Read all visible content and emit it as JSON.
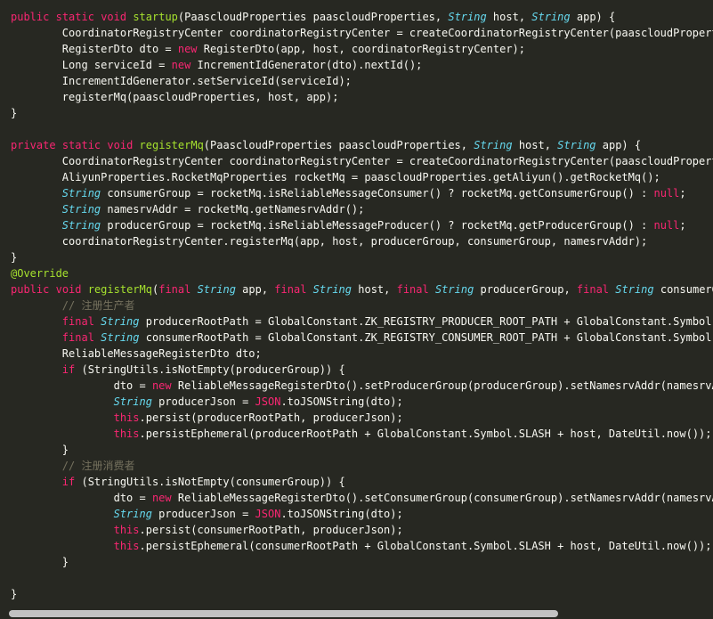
{
  "editor": {
    "scrollbar": {
      "thumb_fraction": 0.79
    },
    "colors": {
      "background": "#272822",
      "keyword": "#f92672",
      "type": "#66d9ef",
      "function": "#a6e22e",
      "comment": "#75715e",
      "plain": "#f8f8f2"
    },
    "lines": [
      [
        [
          "kw",
          "public"
        ],
        [
          "pl",
          " "
        ],
        [
          "kw",
          "static"
        ],
        [
          "pl",
          " "
        ],
        [
          "kw",
          "void"
        ],
        [
          "pl",
          " "
        ],
        [
          "fn",
          "startup"
        ],
        [
          "pl",
          "(PaascloudProperties paascloudProperties, "
        ],
        [
          "ty",
          "String"
        ],
        [
          "pl",
          " host, "
        ],
        [
          "ty",
          "String"
        ],
        [
          "pl",
          " app) {"
        ]
      ],
      [
        [
          "pl",
          "        CoordinatorRegistryCenter coordinatorRegistryCenter = createCoordinatorRegistryCenter(paascloudPropert"
        ]
      ],
      [
        [
          "pl",
          "        RegisterDto dto = "
        ],
        [
          "kw",
          "new"
        ],
        [
          "pl",
          " RegisterDto(app, host, coordinatorRegistryCenter);"
        ]
      ],
      [
        [
          "pl",
          "        Long serviceId = "
        ],
        [
          "kw",
          "new"
        ],
        [
          "pl",
          " IncrementIdGenerator(dto).nextId();"
        ]
      ],
      [
        [
          "pl",
          "        IncrementIdGenerator.setServiceId(serviceId);"
        ]
      ],
      [
        [
          "pl",
          "        registerMq(paascloudProperties, host, app);"
        ]
      ],
      [
        [
          "pl",
          "}"
        ]
      ],
      [
        [
          "pl",
          ""
        ]
      ],
      [
        [
          "kw",
          "private"
        ],
        [
          "pl",
          " "
        ],
        [
          "kw",
          "static"
        ],
        [
          "pl",
          " "
        ],
        [
          "kw",
          "void"
        ],
        [
          "pl",
          " "
        ],
        [
          "fn",
          "registerMq"
        ],
        [
          "pl",
          "(PaascloudProperties paascloudProperties, "
        ],
        [
          "ty",
          "String"
        ],
        [
          "pl",
          " host, "
        ],
        [
          "ty",
          "String"
        ],
        [
          "pl",
          " app) {"
        ]
      ],
      [
        [
          "pl",
          "        CoordinatorRegistryCenter coordinatorRegistryCenter = createCoordinatorRegistryCenter(paascloudPropert"
        ]
      ],
      [
        [
          "pl",
          "        AliyunProperties.RocketMqProperties rocketMq = paascloudProperties.getAliyun().getRocketMq();"
        ]
      ],
      [
        [
          "pl",
          "        "
        ],
        [
          "ty",
          "String"
        ],
        [
          "pl",
          " consumerGroup = rocketMq.isReliableMessageConsumer() ? rocketMq.getConsumerGroup() : "
        ],
        [
          "kw",
          "null"
        ],
        [
          "pl",
          ";"
        ]
      ],
      [
        [
          "pl",
          "        "
        ],
        [
          "ty",
          "String"
        ],
        [
          "pl",
          " namesrvAddr = rocketMq.getNamesrvAddr();"
        ]
      ],
      [
        [
          "pl",
          "        "
        ],
        [
          "ty",
          "String"
        ],
        [
          "pl",
          " producerGroup = rocketMq.isReliableMessageProducer() ? rocketMq.getProducerGroup() : "
        ],
        [
          "kw",
          "null"
        ],
        [
          "pl",
          ";"
        ]
      ],
      [
        [
          "pl",
          "        coordinatorRegistryCenter.registerMq(app, host, producerGroup, consumerGroup, namesrvAddr);"
        ]
      ],
      [
        [
          "pl",
          "}"
        ]
      ],
      [
        [
          "an",
          "@Override"
        ]
      ],
      [
        [
          "kw",
          "public"
        ],
        [
          "pl",
          " "
        ],
        [
          "kw",
          "void"
        ],
        [
          "pl",
          " "
        ],
        [
          "fn",
          "registerMq"
        ],
        [
          "pl",
          "("
        ],
        [
          "kw",
          "final"
        ],
        [
          "pl",
          " "
        ],
        [
          "ty",
          "String"
        ],
        [
          "pl",
          " app, "
        ],
        [
          "kw",
          "final"
        ],
        [
          "pl",
          " "
        ],
        [
          "ty",
          "String"
        ],
        [
          "pl",
          " host, "
        ],
        [
          "kw",
          "final"
        ],
        [
          "pl",
          " "
        ],
        [
          "ty",
          "String"
        ],
        [
          "pl",
          " producerGroup, "
        ],
        [
          "kw",
          "final"
        ],
        [
          "pl",
          " "
        ],
        [
          "ty",
          "String"
        ],
        [
          "pl",
          " consumerG"
        ]
      ],
      [
        [
          "pl",
          "        "
        ],
        [
          "cm",
          "// 注册生产者"
        ]
      ],
      [
        [
          "pl",
          "        "
        ],
        [
          "kw",
          "final"
        ],
        [
          "pl",
          " "
        ],
        [
          "ty",
          "String"
        ],
        [
          "pl",
          " producerRootPath = GlobalConstant.ZK_REGISTRY_PRODUCER_ROOT_PATH + GlobalConstant.Symbol."
        ]
      ],
      [
        [
          "pl",
          "        "
        ],
        [
          "kw",
          "final"
        ],
        [
          "pl",
          " "
        ],
        [
          "ty",
          "String"
        ],
        [
          "pl",
          " consumerRootPath = GlobalConstant.ZK_REGISTRY_CONSUMER_ROOT_PATH + GlobalConstant.Symbol."
        ]
      ],
      [
        [
          "pl",
          "        ReliableMessageRegisterDto dto;"
        ]
      ],
      [
        [
          "pl",
          "        "
        ],
        [
          "kw",
          "if"
        ],
        [
          "pl",
          " (StringUtils.isNotEmpty(producerGroup)) {"
        ]
      ],
      [
        [
          "pl",
          "                dto = "
        ],
        [
          "kw",
          "new"
        ],
        [
          "pl",
          " ReliableMessageRegisterDto().setProducerGroup(producerGroup).setNamesrvAddr(namesrvA"
        ]
      ],
      [
        [
          "pl",
          "                "
        ],
        [
          "ty",
          "String"
        ],
        [
          "pl",
          " producerJson = "
        ],
        [
          "kw",
          "JSON"
        ],
        [
          "pl",
          ".toJSONString(dto);"
        ]
      ],
      [
        [
          "pl",
          "                "
        ],
        [
          "kw",
          "this"
        ],
        [
          "pl",
          ".persist(producerRootPath, producerJson);"
        ]
      ],
      [
        [
          "pl",
          "                "
        ],
        [
          "kw",
          "this"
        ],
        [
          "pl",
          ".persistEphemeral(producerRootPath + GlobalConstant.Symbol.SLASH + host, DateUtil.now());"
        ]
      ],
      [
        [
          "pl",
          "        }"
        ]
      ],
      [
        [
          "pl",
          "        "
        ],
        [
          "cm",
          "// 注册消费者"
        ]
      ],
      [
        [
          "pl",
          "        "
        ],
        [
          "kw",
          "if"
        ],
        [
          "pl",
          " (StringUtils.isNotEmpty(consumerGroup)) {"
        ]
      ],
      [
        [
          "pl",
          "                dto = "
        ],
        [
          "kw",
          "new"
        ],
        [
          "pl",
          " ReliableMessageRegisterDto().setConsumerGroup(consumerGroup).setNamesrvAddr(namesrvA"
        ]
      ],
      [
        [
          "pl",
          "                "
        ],
        [
          "ty",
          "String"
        ],
        [
          "pl",
          " producerJson = "
        ],
        [
          "kw",
          "JSON"
        ],
        [
          "pl",
          ".toJSONString(dto);"
        ]
      ],
      [
        [
          "pl",
          "                "
        ],
        [
          "kw",
          "this"
        ],
        [
          "pl",
          ".persist(consumerRootPath, producerJson);"
        ]
      ],
      [
        [
          "pl",
          "                "
        ],
        [
          "kw",
          "this"
        ],
        [
          "pl",
          ".persistEphemeral(consumerRootPath + GlobalConstant.Symbol.SLASH + host, DateUtil.now());"
        ]
      ],
      [
        [
          "pl",
          "        }"
        ]
      ],
      [
        [
          "pl",
          ""
        ]
      ],
      [
        [
          "pl",
          "}"
        ]
      ]
    ]
  }
}
